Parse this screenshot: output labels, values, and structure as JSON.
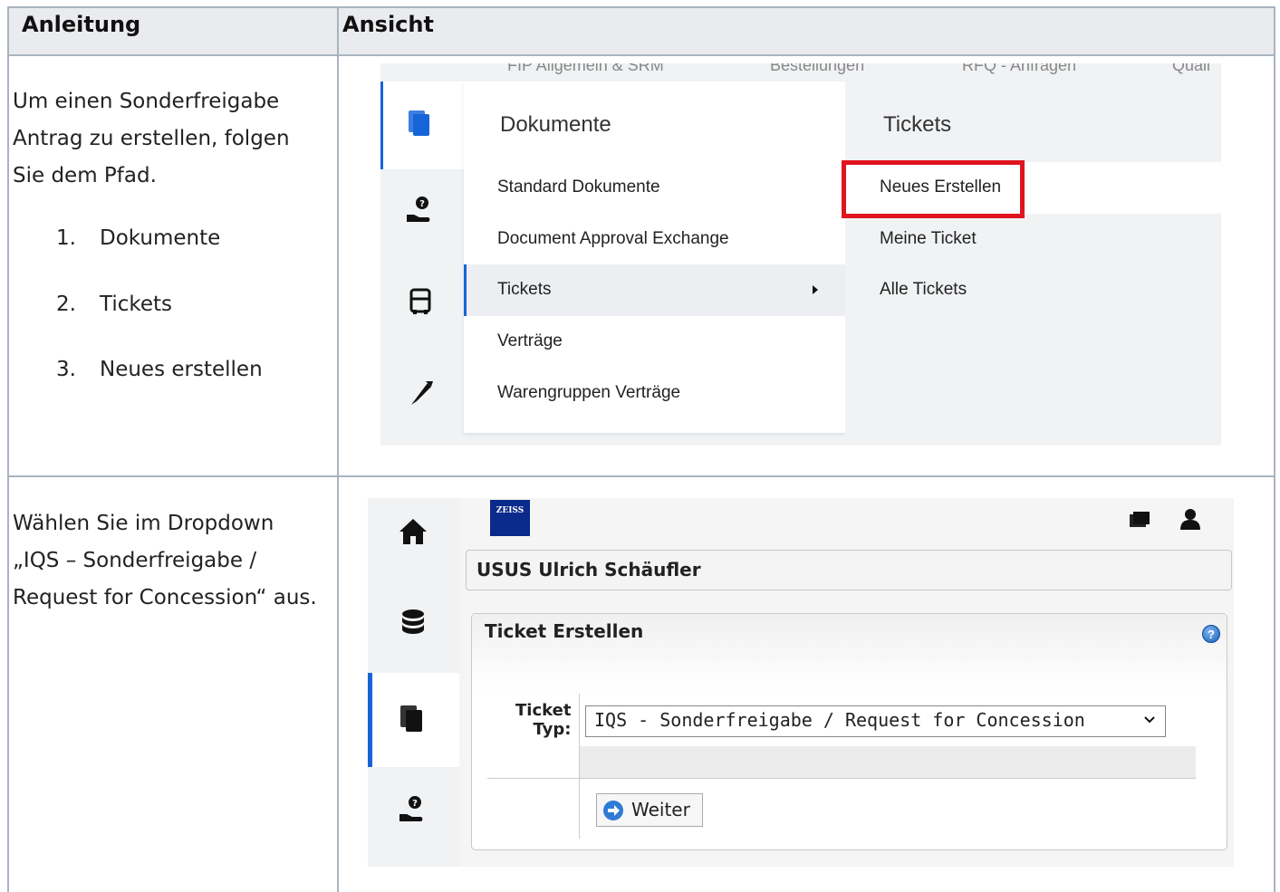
{
  "table": {
    "header_left": "Anleitung",
    "header_right": "Ansicht"
  },
  "row1": {
    "instruction": "Um einen Sonderfreigabe Antrag zu erstellen, folgen Sie dem Pfad.",
    "steps": [
      {
        "num": "1.",
        "text": "Dokumente"
      },
      {
        "num": "2.",
        "text": "Tickets"
      },
      {
        "num": "3.",
        "text": "Neues erstellen"
      }
    ]
  },
  "row2": {
    "instruction": "Wählen Sie im Dropdown „IQS – Sonderfreigabe / Request for Concession“ aus."
  },
  "screenshot1": {
    "topnav": [
      "FIP Allgemein & SRM",
      "Bestellungen",
      "RFQ - Anfragen",
      "Quali"
    ],
    "rail_icons": [
      "documents-icon",
      "help-hand-icon",
      "truck-icon",
      "caliper-icon"
    ],
    "panel1": {
      "title": "Dokumente",
      "items": [
        "Standard Dokumente",
        "Document Approval Exchange",
        "Tickets",
        "Verträge",
        "Warengruppen Verträge"
      ],
      "active_index": 2
    },
    "panel2": {
      "title": "Tickets",
      "items": [
        "Neues Erstellen",
        "Meine Ticket",
        "Alle Tickets"
      ],
      "highlighted_index": 0
    },
    "highlight_color": "#e0141e",
    "accent_color": "#1565d8"
  },
  "screenshot2": {
    "logo_text": "ZEISS",
    "rail_icons": [
      "home-icon",
      "database-icon",
      "documents-icon",
      "help-hand-icon"
    ],
    "user_name": "USUS Ulrich Schäufler",
    "ticket_title": "Ticket Erstellen",
    "help_symbol": "?",
    "field_label_line1": "Ticket",
    "field_label_line2": "Typ:",
    "selected_option": "IQS - Sonderfreigabe / Request for Concession",
    "button_label": "Weiter"
  }
}
